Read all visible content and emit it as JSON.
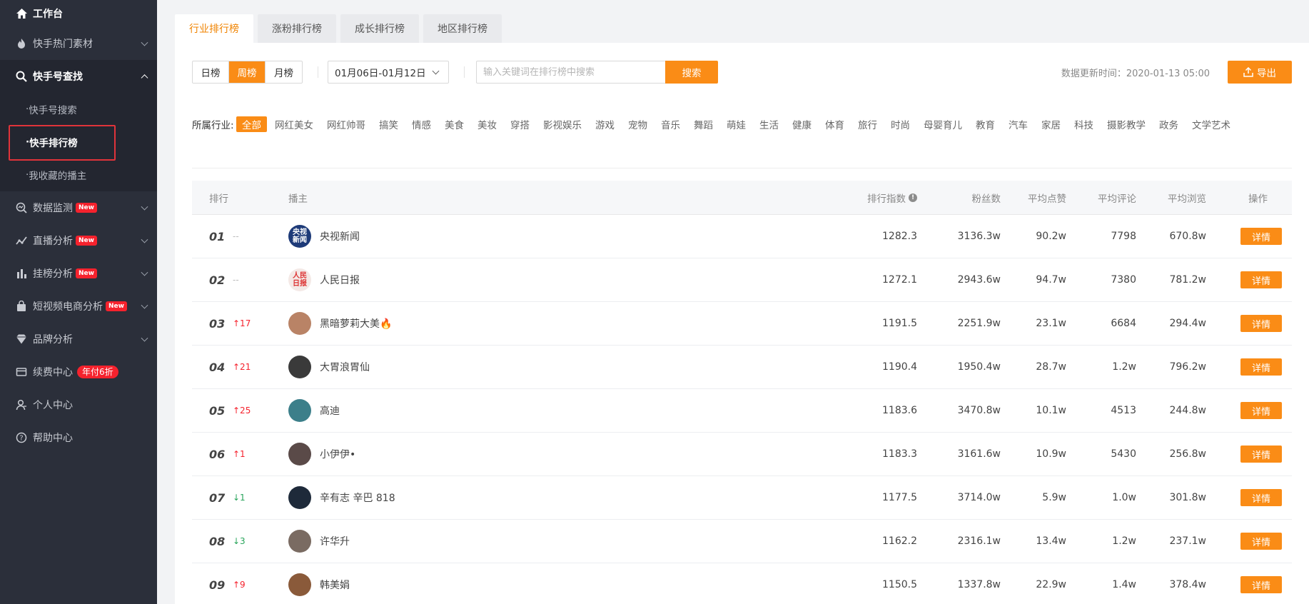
{
  "sidebar": {
    "workbench": "工作台",
    "hot_material": "快手热门素材",
    "lookup": "快手号查找",
    "sub_items": [
      "快手号搜索",
      "快手排行榜",
      "我收藏的播主"
    ],
    "data_monitor": "数据监测",
    "live_analysis": "直播分析",
    "rank_analysis": "挂榜分析",
    "ecommerce_analysis": "短视频电商分析",
    "brand_analysis": "品牌分析",
    "renew_center": "续费中心",
    "renew_badge": "年付6折",
    "personal_center": "个人中心",
    "help_center": "帮助中心",
    "new_badge": "New"
  },
  "tabs": [
    "行业排行榜",
    "涨粉排行榜",
    "成长排行榜",
    "地区排行榜"
  ],
  "toolbar": {
    "periods": [
      "日榜",
      "周榜",
      "月榜"
    ],
    "date_range": "01月06日-01月12日",
    "search_placeholder": "输入关键词在排行榜中搜索",
    "search_label": "搜索",
    "update_time": "数据更新时间：2020-01-13 05:00",
    "export_label": "导出"
  },
  "filter": {
    "label": "所属行业:",
    "tags": [
      "全部",
      "网红美女",
      "网红帅哥",
      "搞笑",
      "情感",
      "美食",
      "美妆",
      "穿搭",
      "影视娱乐",
      "游戏",
      "宠物",
      "音乐",
      "舞蹈",
      "萌娃",
      "生活",
      "健康",
      "体育",
      "旅行",
      "时尚",
      "母婴育儿",
      "教育",
      "汽车",
      "家居",
      "科技",
      "摄影教学",
      "政务",
      "文学艺术"
    ]
  },
  "table": {
    "headers": {
      "rank": "排行",
      "anchor": "播主",
      "index": "排行指数",
      "fans": "粉丝数",
      "avg_like": "平均点赞",
      "avg_comment": "平均评论",
      "avg_view": "平均浏览",
      "op": "操作"
    },
    "detail_label": "详情",
    "rows": [
      {
        "rank": "01",
        "change": "--",
        "dir": "flat",
        "name": "央视新闻",
        "avatar_text": "央视新闻",
        "avatar_color": "#1d3a78",
        "index": "1282.3",
        "fans": "3136.3w",
        "like": "90.2w",
        "comment": "7798",
        "view": "670.8w"
      },
      {
        "rank": "02",
        "change": "--",
        "dir": "flat",
        "name": "人民日报",
        "avatar_text": "人民日报",
        "avatar_color": "#f4e9e6",
        "index": "1272.1",
        "fans": "2943.6w",
        "like": "94.7w",
        "comment": "7380",
        "view": "781.2w"
      },
      {
        "rank": "03",
        "change": "↑17",
        "dir": "up",
        "name": "黑暗萝莉大美🔥",
        "avatar_text": "",
        "avatar_color": "#b98366",
        "index": "1191.5",
        "fans": "2251.9w",
        "like": "23.1w",
        "comment": "6684",
        "view": "294.4w"
      },
      {
        "rank": "04",
        "change": "↑21",
        "dir": "up",
        "name": "大胃浪胃仙",
        "avatar_text": "",
        "avatar_color": "#3a3a3a",
        "index": "1190.4",
        "fans": "1950.4w",
        "like": "28.7w",
        "comment": "1.2w",
        "view": "796.2w"
      },
      {
        "rank": "05",
        "change": "↑25",
        "dir": "up",
        "name": "高迪",
        "avatar_text": "",
        "avatar_color": "#3c7f8a",
        "index": "1183.6",
        "fans": "3470.8w",
        "like": "10.1w",
        "comment": "4513",
        "view": "244.8w"
      },
      {
        "rank": "06",
        "change": "↑1",
        "dir": "up",
        "name": "小伊伊•",
        "avatar_text": "",
        "avatar_color": "#5a4a48",
        "index": "1183.3",
        "fans": "3161.6w",
        "like": "10.9w",
        "comment": "5430",
        "view": "256.8w"
      },
      {
        "rank": "07",
        "change": "↓1",
        "dir": "down",
        "name": "辛有志 辛巴 818",
        "avatar_text": "",
        "avatar_color": "#1e2a3a",
        "index": "1177.5",
        "fans": "3714.0w",
        "like": "5.9w",
        "comment": "1.0w",
        "view": "301.8w"
      },
      {
        "rank": "08",
        "change": "↓3",
        "dir": "down",
        "name": "许华升",
        "avatar_text": "",
        "avatar_color": "#7a6b62",
        "index": "1162.2",
        "fans": "2316.1w",
        "like": "13.4w",
        "comment": "1.2w",
        "view": "237.1w"
      },
      {
        "rank": "09",
        "change": "↑9",
        "dir": "up",
        "name": "韩美娟",
        "avatar_text": "",
        "avatar_color": "#8a5a3a",
        "index": "1150.5",
        "fans": "1337.8w",
        "like": "22.9w",
        "comment": "1.4w",
        "view": "378.4w"
      }
    ]
  }
}
